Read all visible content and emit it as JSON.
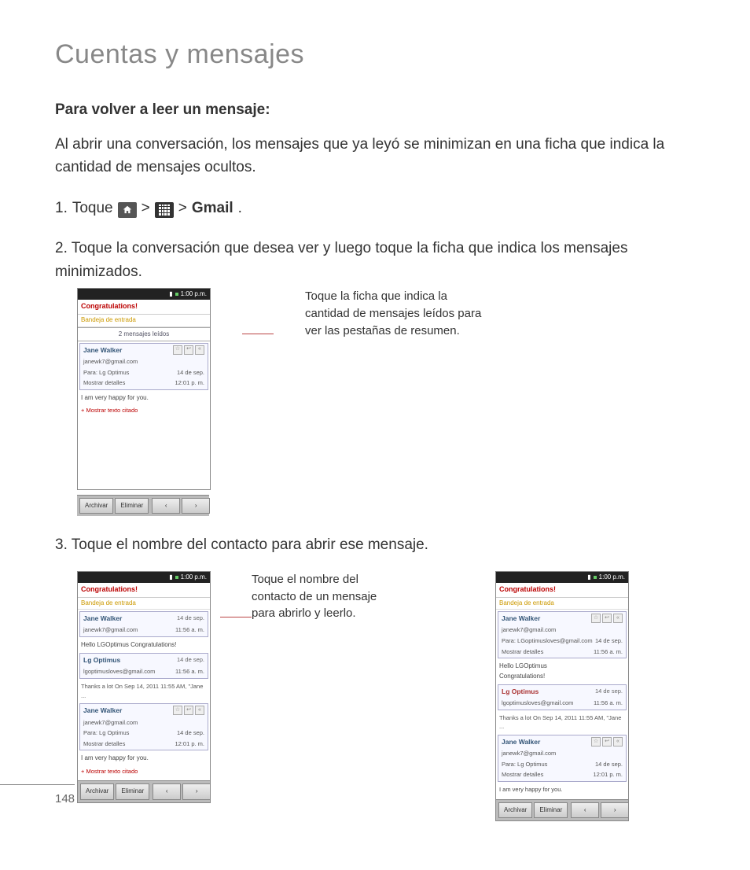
{
  "page": {
    "title": "Cuentas y mensajes",
    "number": "148"
  },
  "section": {
    "heading": "Para volver a leer un mensaje:",
    "intro": "Al abrir una conversación, los mensajes que ya leyó se minimizan en una ficha que indica la cantidad de mensajes ocultos."
  },
  "steps": {
    "s1": {
      "num": "1.",
      "lead": "Toque",
      "sep": ">",
      "gmail": "Gmail",
      "dot": "."
    },
    "s2": {
      "num": "2.",
      "text": "Toque la conversación que desea ver y luego toque la ficha que indica los mensajes minimizados."
    },
    "s3": {
      "num": "3.",
      "text": "Toque el nombre del contacto para abrir ese mensaje."
    }
  },
  "callouts": {
    "c1": "Toque la ficha que indica la cantidad de mensajes leídos para ver las pestañas de resumen.",
    "c2": "Toque el nombre del contacto de un mensaje para abrirlo y leerlo."
  },
  "shot": {
    "time": "1:00 p.m.",
    "subject": "Congratulations!",
    "inbox": "Bandeja de entrada",
    "read_tab": "2 mensajes leídos",
    "names": {
      "jane": "Jane Walker",
      "lg": "Lg Optimus"
    },
    "emails": {
      "jane": "janewk7@gmail.com",
      "lg": "lgoptimusloves@gmail.com"
    },
    "para": {
      "to": "Para:",
      "lgopt": "Lg Optimus",
      "lgopt_email": "LGoptimusloves@gmail.com"
    },
    "date": "14 de sep.",
    "time2": "12:01 p. m.",
    "time3": "11:56 a. m.",
    "details": "Mostrar detalles",
    "body_happy": "I am very happy for you.",
    "body_hello": "Hello LGOptimus Congratulations!",
    "body_hello2": "Hello LGOptimus\nCongratulations!",
    "body_thanks": "Thanks a lot On Sep 14, 2011 11:55 AM, \"Jane ...",
    "show_quoted": "+ Mostrar texto citado",
    "btn_archive": "Archivar",
    "btn_delete": "Eliminar",
    "arrow_l": "‹",
    "arrow_r": "›"
  }
}
